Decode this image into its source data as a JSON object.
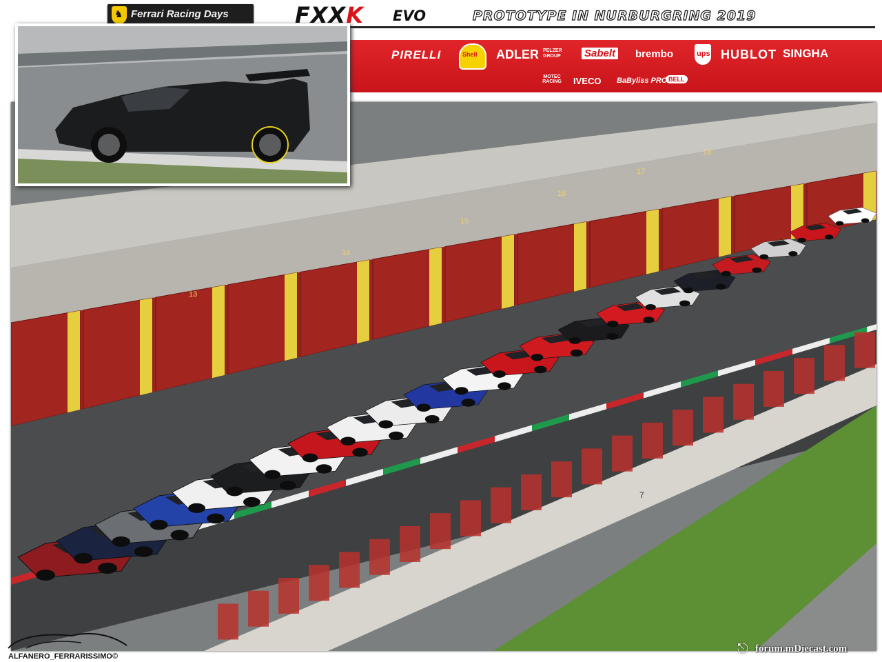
{
  "header": {
    "brand_logo_text": "Ferrari Racing Days",
    "title_model": "FXX",
    "title_model_k": "K",
    "title_evo": "EVO",
    "title_subtitle": "PROTOTYPE IN NURBURGRING 2019"
  },
  "sponsors": {
    "row1": [
      "PIRELLI",
      "Shell",
      "ADLER",
      "PELZER GROUP",
      "Sabelt",
      "brembo",
      "ups",
      "HUBLOT",
      "SINGHA"
    ],
    "row2": [
      "MOTEC RACING",
      "IVECO",
      "BaByliss PRO",
      "BELL"
    ]
  },
  "colors": {
    "ferrari_red": "#d9141b",
    "ferrari_yellow": "#f4c900",
    "sponsor_band": "#d41c21",
    "kerb_green": "#1f9a4c"
  },
  "icons": {
    "brand": "prancing-horse-shield-icon",
    "signature": "car-silhouette-icon",
    "forum": "diecast-car-icon"
  },
  "photo": {
    "garage_numbers": [
      "13",
      "14",
      "15",
      "16",
      "17",
      "18"
    ],
    "pit_wall_marker": "7"
  },
  "footer": {
    "signature": "ALFANERO_FERRARISSIMO©",
    "watermark": "forum.mDiecast.com"
  }
}
